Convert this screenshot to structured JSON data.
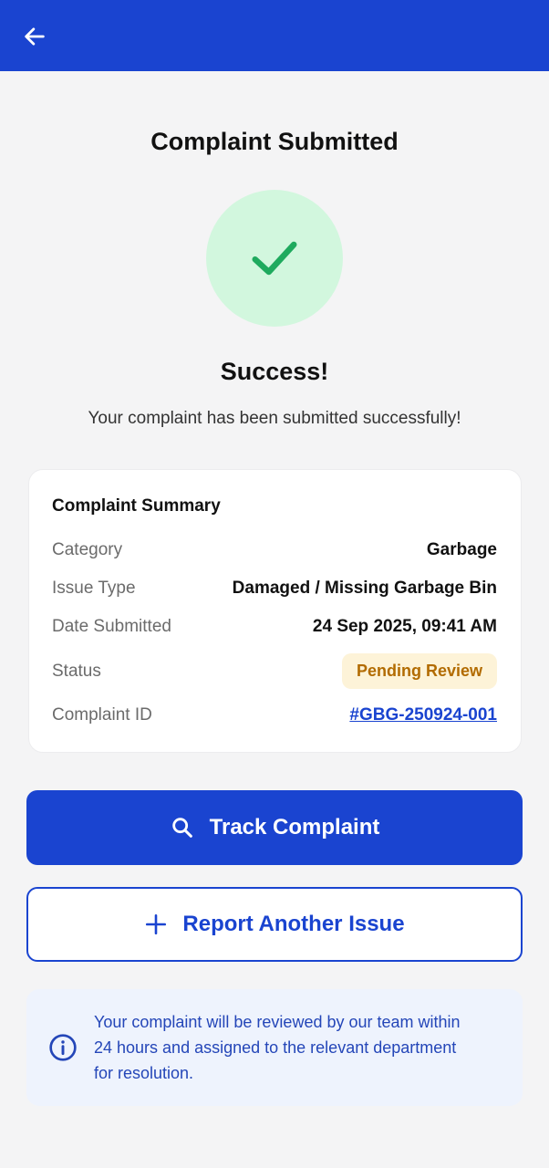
{
  "header": {
    "back_icon": "arrow-left-icon",
    "color": "#1a44d0"
  },
  "page_title": "Complaint Submitted",
  "success": {
    "icon": "check-icon",
    "heading": "Success!",
    "message": "Your complaint has been submitted successfully!"
  },
  "summary": {
    "title": "Complaint Summary",
    "rows": [
      {
        "label": "Category",
        "value": "Garbage"
      },
      {
        "label": "Issue Type",
        "value": "Damaged / Missing Garbage Bin"
      },
      {
        "label": "Date Submitted",
        "value": "24 Sep 2025, 09:41 AM"
      },
      {
        "label": "Status",
        "value": "Pending Review"
      },
      {
        "label": "Complaint ID",
        "value": "#GBG-250924-001"
      }
    ]
  },
  "buttons": {
    "track_label": "Track Complaint",
    "track_icon": "search-icon",
    "report_label": "Report Another Issue",
    "report_icon": "plus-icon"
  },
  "info": {
    "icon": "info-icon",
    "text": "Your complaint will be reviewed by our team within 24 hours and assigned to the relevant department for resolution."
  },
  "colors": {
    "primary": "#1a44d0",
    "success_bg": "#d2f7de",
    "success_check": "#1faa5e",
    "status_bg": "#fdf3d8",
    "status_text": "#b26b00"
  }
}
